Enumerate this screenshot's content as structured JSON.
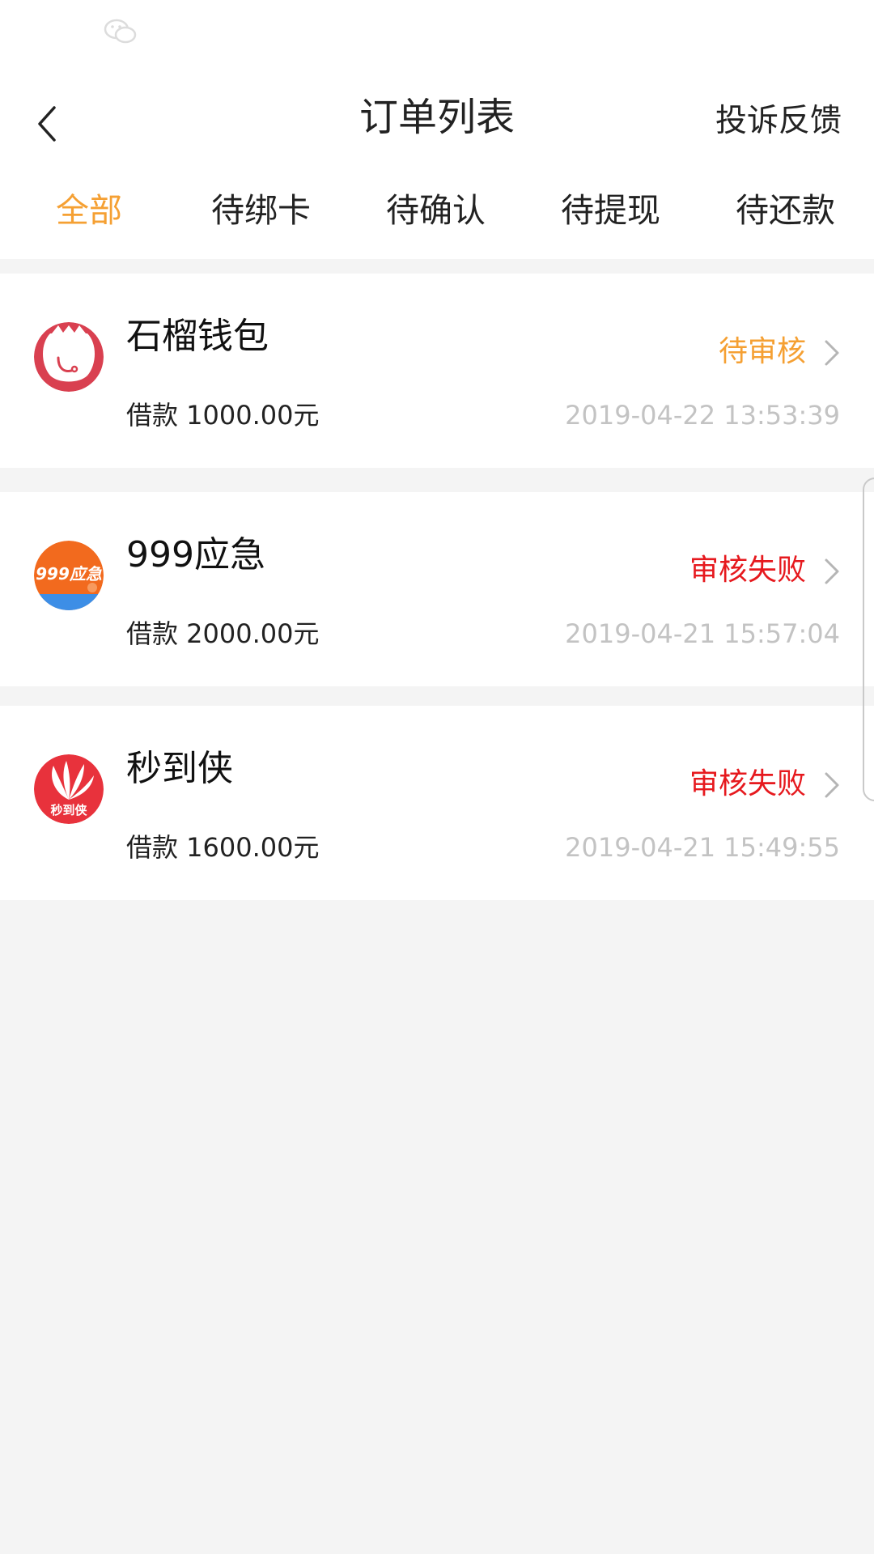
{
  "header": {
    "title": "订单列表",
    "feedback_label": "投诉反馈"
  },
  "tabs": [
    {
      "label": "全部",
      "active": true
    },
    {
      "label": "待绑卡",
      "active": false
    },
    {
      "label": "待确认",
      "active": false
    },
    {
      "label": "待提现",
      "active": false
    },
    {
      "label": "待还款",
      "active": false
    }
  ],
  "orders": [
    {
      "name": "石榴钱包",
      "status": "待审核",
      "status_color": "#f5a033",
      "amount": "借款 1000.00元",
      "time": "2019-04-22 13:53:39",
      "icon": "pomegranate-logo-icon"
    },
    {
      "name": "999应急",
      "status": "审核失败",
      "status_color": "#e6191e",
      "amount": "借款 2000.00元",
      "time": "2019-04-21 15:57:04",
      "icon": "999-emergency-logo-icon",
      "logo_text": "999应急"
    },
    {
      "name": "秒到侠",
      "status": "审核失败",
      "status_color": "#e6191e",
      "amount": "借款 1600.00元",
      "time": "2019-04-21 15:49:55",
      "icon": "miaodaoxia-logo-icon",
      "logo_text": "秒到侠"
    }
  ],
  "colors": {
    "accent": "#f5a033",
    "failed": "#e6191e",
    "muted": "#c3c3c3",
    "background": "#f4f4f4"
  }
}
